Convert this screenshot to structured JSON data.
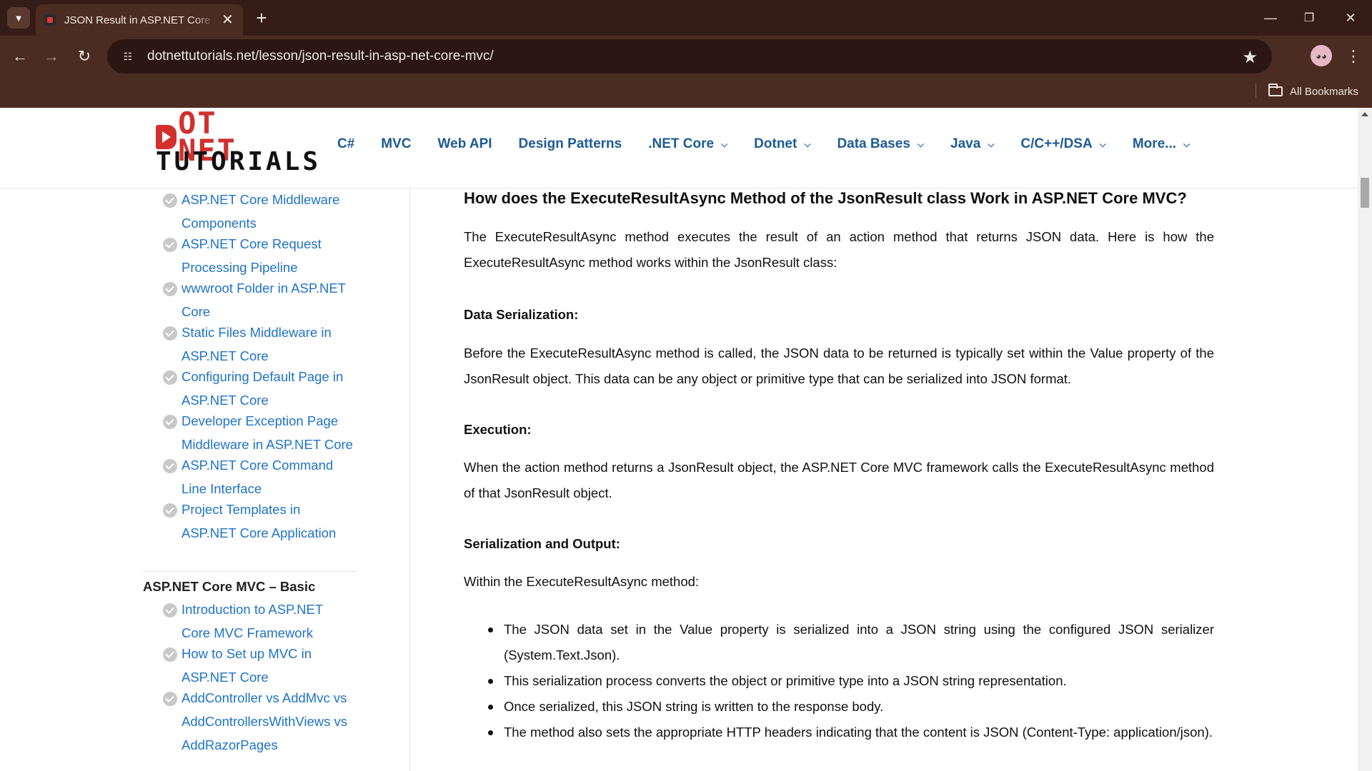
{
  "browser": {
    "tab_title": "JSON Result in ASP.NET Core MVC",
    "url": "dotnettutorials.net/lesson/json-result-in-asp-net-core-mvc/",
    "bookmarks_label": "All Bookmarks"
  },
  "site": {
    "logo_line1": "OT NET",
    "logo_line2": "TUTORIALS",
    "nav": [
      {
        "label": "C#",
        "dropdown": false
      },
      {
        "label": "MVC",
        "dropdown": false
      },
      {
        "label": "Web API",
        "dropdown": false
      },
      {
        "label": "Design Patterns",
        "dropdown": false
      },
      {
        "label": ".NET Core",
        "dropdown": true
      },
      {
        "label": "Dotnet",
        "dropdown": true
      },
      {
        "label": "Data Bases",
        "dropdown": true
      },
      {
        "label": "Java",
        "dropdown": true
      },
      {
        "label": "C/C++/DSA",
        "dropdown": true
      },
      {
        "label": "More...",
        "dropdown": true
      }
    ]
  },
  "sidebar": {
    "items_top": [
      {
        "line1": "ASP.NET Core Middleware",
        "line2": "Components"
      },
      {
        "line1": "ASP.NET Core Request",
        "line2": "Processing Pipeline"
      },
      {
        "line1": "wwwroot Folder in ASP.NET",
        "line2": "Core"
      },
      {
        "line1": "Static Files Middleware in",
        "line2": "ASP.NET Core"
      },
      {
        "line1": "Configuring Default Page in",
        "line2": "ASP.NET Core"
      },
      {
        "line1": "Developer Exception Page",
        "line2": "Middleware in ASP.NET Core"
      },
      {
        "line1": "ASP.NET Core Command",
        "line2": "Line Interface"
      },
      {
        "line1": "Project Templates in",
        "line2": "ASP.NET Core Application"
      }
    ],
    "section_heading": "ASP.NET Core MVC – Basic",
    "items_bottom": [
      {
        "line1": "Introduction to ASP.NET",
        "line2": "Core MVC Framework"
      },
      {
        "line1": "How to Set up MVC in",
        "line2": "ASP.NET Core"
      },
      {
        "line1": "AddController vs AddMvc vs",
        "line2": "AddControllersWithViews vs",
        "line3": "AddRazorPages"
      }
    ]
  },
  "article": {
    "heading": "How does the ExecuteResultAsync Method of the JsonResult class Work in ASP.NET Core MVC?",
    "intro": "The ExecuteResultAsync method executes the result of an action method that returns JSON data. Here is how the ExecuteResultAsync method works within the JsonResult class:",
    "sections": [
      {
        "title": "Data Serialization:",
        "text": "Before the ExecuteResultAsync method is called, the JSON data to be returned is typically set within the Value property of the JsonResult object. This data can be any object or primitive type that can be serialized into JSON format."
      },
      {
        "title": "Execution:",
        "text": "When the action method returns a JsonResult object, the ASP.NET Core MVC framework calls the ExecuteResultAsync method of that JsonResult object."
      },
      {
        "title": "Serialization and Output:",
        "text": "Within the ExecuteResultAsync method:"
      }
    ],
    "bullets": [
      "The JSON data set in the Value property is serialized into a JSON string using the configured JSON serializer (System.Text.Json).",
      "This serialization process converts the object or primitive type into a JSON string representation.",
      "Once serialized, this JSON string is written to the response body.",
      "The method also sets the appropriate HTTP headers indicating that the content is JSON (Content-Type: application/json)."
    ]
  }
}
